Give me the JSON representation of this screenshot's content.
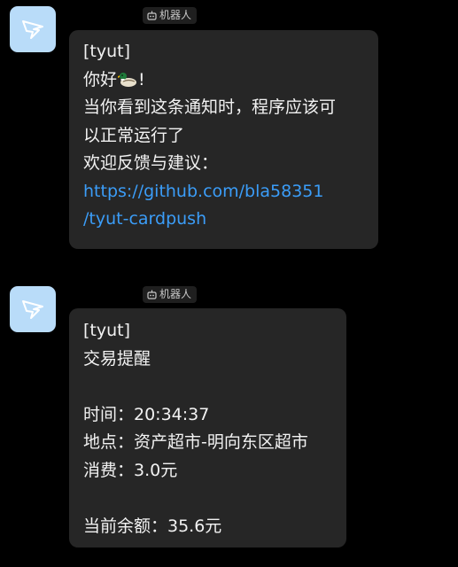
{
  "messages": [
    {
      "sender_tag": "机器人",
      "header": "[tyut]",
      "greeting_prefix": "你好",
      "greeting_emoji": "duck-emoji",
      "greeting_suffix": "!",
      "line_1": "当你看到这条通知时，程序应该可",
      "line_2": "以正常运行了",
      "line_3": "欢迎反馈与建议：",
      "link_line_1": "https://github.com/bla58351",
      "link_line_2": "/tyut-cardpush"
    },
    {
      "sender_tag": "机器人",
      "header": "[tyut]",
      "title": "交易提醒",
      "time_line": "时间：20:34:37",
      "place_line": "地点：资产超市-明向东区超市",
      "spend_line": "消费：3.0元",
      "balance_line": "当前余额：35.6元"
    }
  ],
  "colors": {
    "background": "#000000",
    "bubble": "#262626",
    "avatar": "#b9dcf9",
    "link": "#3b9df8",
    "text": "#f2f2f2"
  },
  "icons": {
    "avatar": "dingtalk-bird-icon",
    "robot": "robot-icon"
  }
}
